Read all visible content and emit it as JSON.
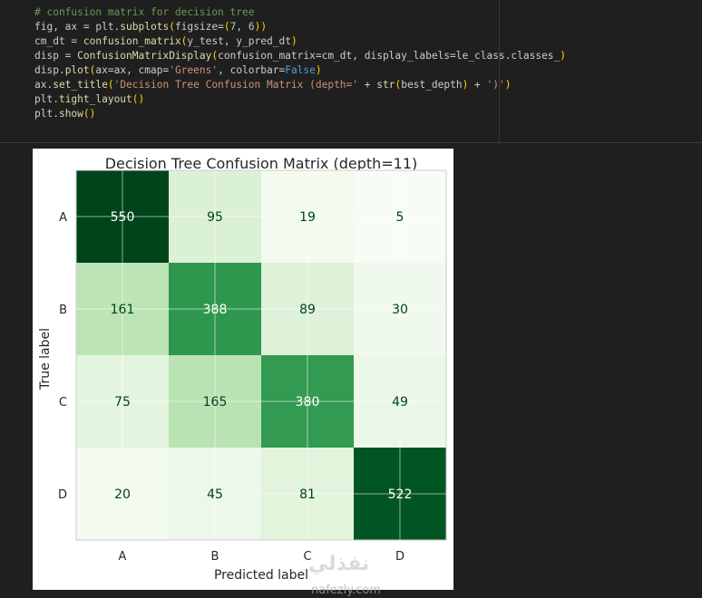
{
  "code_cell": {
    "lines": [
      "# confusion matrix for decision tree",
      "fig, ax = plt.subplots(figsize=(7, 6))",
      "cm_dt = confusion_matrix(y_test, y_pred_dt)",
      "disp = ConfusionMatrixDisplay(confusion_matrix=cm_dt, display_labels=le_class.classes_)",
      "disp.plot(ax=ax, cmap='Greens', colorbar=False)",
      "ax.set_title('Decision Tree Confusion Matrix (depth=' + str(best_depth) + ')')",
      "plt.tight_layout()",
      "plt.show()"
    ]
  },
  "chart_data": {
    "type": "heatmap",
    "title": "Decision Tree Confusion Matrix (depth=11)",
    "xlabel": "Predicted label",
    "ylabel": "True label",
    "x_categories": [
      "A",
      "B",
      "C",
      "D"
    ],
    "y_categories": [
      "A",
      "B",
      "C",
      "D"
    ],
    "values": [
      [
        550,
        95,
        19,
        5
      ],
      [
        161,
        388,
        89,
        30
      ],
      [
        75,
        165,
        380,
        49
      ],
      [
        20,
        45,
        81,
        522
      ]
    ],
    "colormap": "Greens",
    "colorbar": false,
    "grid": true
  },
  "watermark": {
    "arabic": "نفذلي",
    "url": "nafezly.com"
  },
  "colors": {
    "background": "#1f1f1f",
    "comment": "#6a9955",
    "text": "#cccccc",
    "string": "#ce9178",
    "number": "#b5cea8",
    "keyword": "#569cd6",
    "function": "#dcdcaa",
    "bracket": "#ffd700"
  }
}
